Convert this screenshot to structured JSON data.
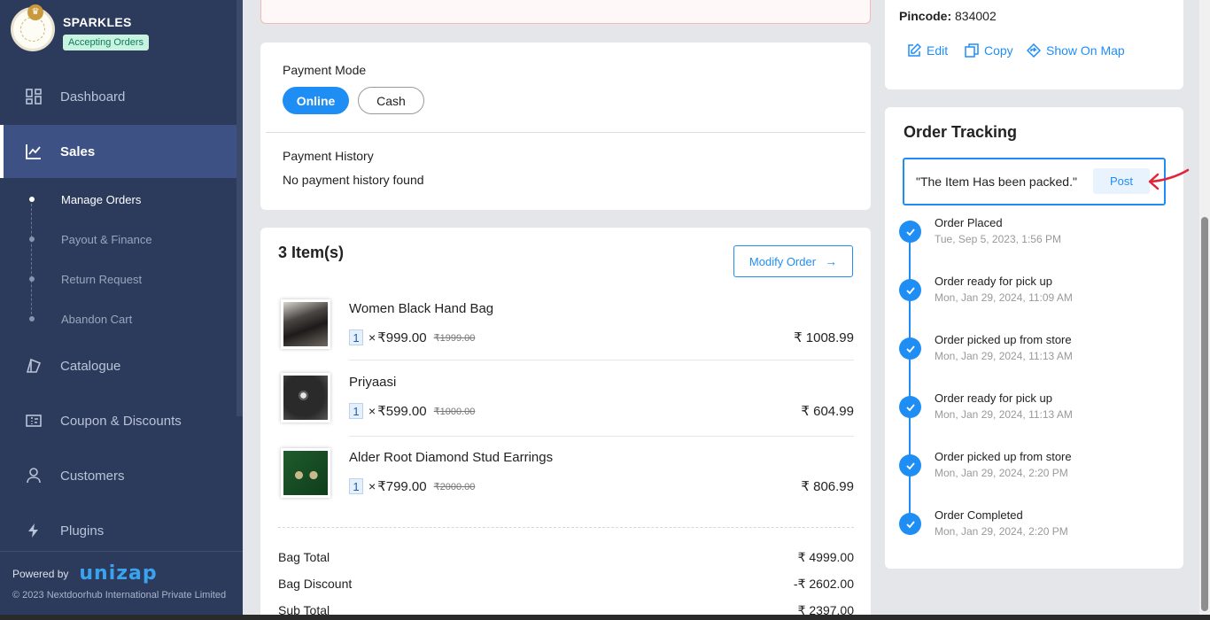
{
  "sidebar": {
    "brand_name": "SPARKLES",
    "status_badge": "Accepting Orders",
    "nav": {
      "dashboard": "Dashboard",
      "sales": "Sales",
      "catalogue": "Catalogue",
      "coupons": "Coupon & Discounts",
      "customers": "Customers",
      "plugins": "Plugins"
    },
    "sub_items": {
      "manage_orders": "Manage Orders",
      "payout": "Payout & Finance",
      "returns": "Return Request",
      "abandon_cart": "Abandon Cart"
    },
    "powered_by": "Powered by",
    "powered_brand": "unizap",
    "copyright": "© 2023 Nextdoorhub International Private Limited"
  },
  "payment": {
    "mode_title": "Payment Mode",
    "online": "Online",
    "cash": "Cash",
    "history_title": "Payment History",
    "history_text": "No payment history found"
  },
  "items": {
    "title": "3 Item(s)",
    "modify_label": "Modify Order",
    "list": [
      {
        "name": "Women Black Hand Bag",
        "qty": "1",
        "times": "×",
        "price": "₹999.00",
        "mrp": "₹1999.00",
        "total": "₹ 1008.99"
      },
      {
        "name": "Priyaasi",
        "qty": "1",
        "times": "×",
        "price": "₹599.00",
        "mrp": "₹1000.00",
        "total": "₹ 604.99"
      },
      {
        "name": "Alder Root Diamond Stud Earrings",
        "qty": "1",
        "times": "×",
        "price": "₹799.00",
        "mrp": "₹2000.00",
        "total": "₹ 806.99"
      }
    ],
    "summary": [
      {
        "label": "Bag Total",
        "value": "₹ 4999.00"
      },
      {
        "label": "Bag Discount",
        "value": "-₹ 2602.00"
      },
      {
        "label": "Sub Total",
        "value": "₹ 2397.00"
      }
    ]
  },
  "address": {
    "pincode_label": "Pincode:",
    "pincode_value": "834002",
    "edit": "Edit",
    "copy": "Copy",
    "map": "Show On Map"
  },
  "tracking": {
    "title": "Order Tracking",
    "input_value": "\"The Item Has been packed.\"",
    "post_label": "Post",
    "steps": [
      {
        "status": "Order Placed",
        "time": "Tue, Sep 5, 2023, 1:56 PM"
      },
      {
        "status": "Order ready for pick up",
        "time": "Mon, Jan 29, 2024, 11:09 AM"
      },
      {
        "status": "Order picked up from store",
        "time": "Mon, Jan 29, 2024, 11:13 AM"
      },
      {
        "status": "Order ready for pick up",
        "time": "Mon, Jan 29, 2024, 11:13 AM"
      },
      {
        "status": "Order picked up from store",
        "time": "Mon, Jan 29, 2024, 2:20 PM"
      },
      {
        "status": "Order Completed",
        "time": "Mon, Jan 29, 2024, 2:20 PM"
      }
    ]
  },
  "colors": {
    "sidebar_bg": "#2c3b5c",
    "active_nav": "#3d5184",
    "accent": "#1e8ef5",
    "annotation_arrow": "#e0243a"
  }
}
